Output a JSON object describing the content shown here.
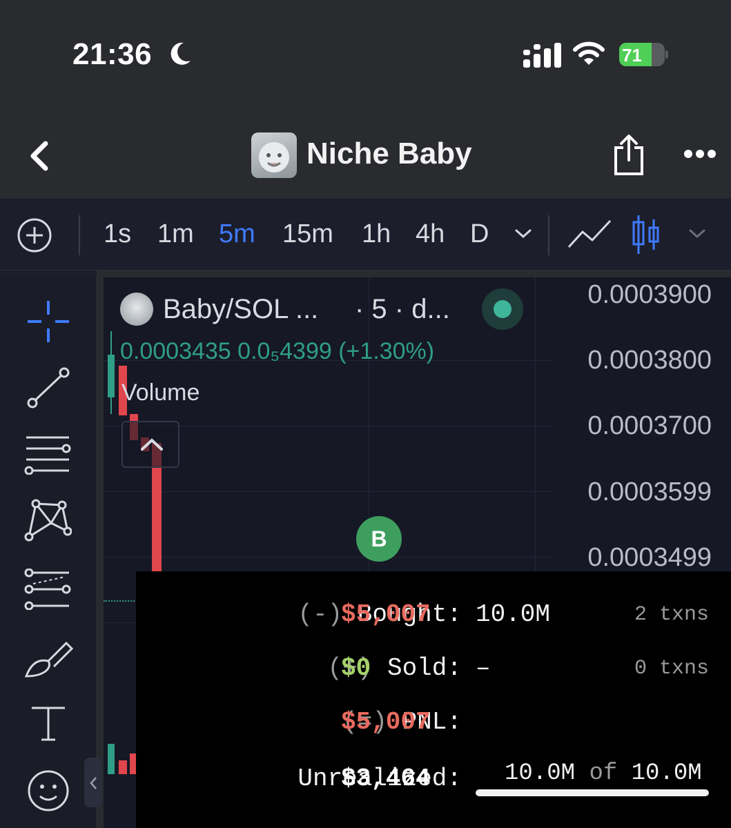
{
  "status_bar": {
    "time": "21:36",
    "battery_level": "71",
    "battery_fraction": 0.71,
    "icons": [
      "moon-icon",
      "signal-icon",
      "wifi-icon",
      "battery-charging-icon"
    ]
  },
  "header": {
    "title": "Niche Baby",
    "icons": [
      "back-chevron-icon",
      "token-avatar",
      "share-icon",
      "more-dots-icon"
    ]
  },
  "toolbar": {
    "timeframes": [
      "1s",
      "1m",
      "5m",
      "15m",
      "1h",
      "4h",
      "D"
    ],
    "active_timeframe": "5m",
    "accent_color": "#3f7bff",
    "icons": [
      "add-circle-icon",
      "chevron-down-icon",
      "line-chart-icon",
      "candlestick-icon",
      "chevron-down-icon"
    ]
  },
  "tools": [
    "crosshair-icon",
    "trend-line-icon",
    "horizontal-lines-icon",
    "pattern-icon",
    "fib-levels-icon",
    "brush-icon",
    "text-tool-icon",
    "emoji-icon"
  ],
  "chart": {
    "legend_title": "Baby/SOL ...",
    "legend_interval": "· 5 · d...",
    "legend_values": "0.0003435  0.0₅4399 (+1.30%)",
    "volume_label": "Volume",
    "marker_label": "B",
    "price_labels": [
      "0.0003900",
      "0.0003800",
      "0.0003700",
      "0.0003599",
      "0.0003499"
    ],
    "up_color": "#2f9e86",
    "down_color": "#e0464c"
  },
  "pnl": {
    "bought": {
      "sign": "(-)",
      "label": "Bought:",
      "value": "$5,007",
      "amount": "10.0M",
      "txns": "2 txns"
    },
    "sold": {
      "sign": "(+)",
      "label": "Sold:",
      "value": "$0",
      "amount": "–",
      "txns": "0 txns"
    },
    "pnl": {
      "sign": "(=)",
      "label": "PNL:",
      "value": "$5,007"
    },
    "unrealized": {
      "label": "Unrealized:",
      "value": "$3,464",
      "held": "10.0M",
      "of": "of",
      "total": "10.0M",
      "held_fraction": 1.0
    }
  }
}
